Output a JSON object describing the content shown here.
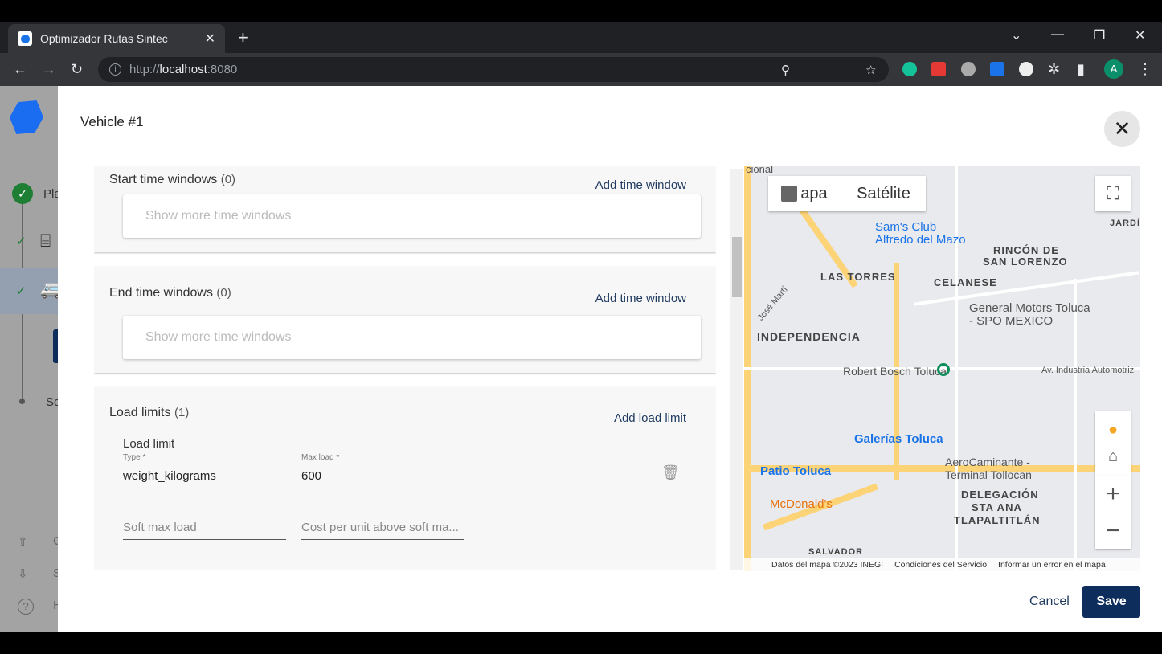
{
  "browser": {
    "tab_title": "Optimizador Rutas Sintec",
    "url_prefix": "http://",
    "url_host": "localhost",
    "url_port": ":8080"
  },
  "sidebar": {
    "step1": "Pla",
    "step4": "Sc",
    "footer": [
      "C",
      "S",
      "H"
    ]
  },
  "modal": {
    "title": "Vehicle #1",
    "start_tw": {
      "title": "Start time windows",
      "count": "(0)",
      "add": "Add time window",
      "more": "Show more time windows"
    },
    "end_tw": {
      "title": "End time windows",
      "count": "(0)",
      "add": "Add time window",
      "more": "Show more time windows"
    },
    "load": {
      "title": "Load limits",
      "count": "(1)",
      "add": "Add load limit",
      "item_title": "Load limit",
      "type_label": "Type *",
      "type_value": "weight_kilograms",
      "max_label": "Max load *",
      "max_value": "600",
      "soft_placeholder": "Soft max load",
      "cost_placeholder": "Cost per unit above soft ma..."
    },
    "cancel": "Cancel",
    "save": "Save"
  },
  "map": {
    "type_map": "apa",
    "type_sat": "Satélite",
    "labels": [
      "Sam's Club",
      "Alfredo del Mazo",
      "RINCÓN DE",
      "SAN LORENZO",
      "LAS TORRES",
      "CELANESE",
      "General Motors Toluca",
      "- SPO MEXICO",
      "INDEPENDENCIA",
      "Robert Bosch Toluca",
      "Av. Industria Automotriz",
      "Galerías Toluca",
      "Patio Toluca",
      "AeroCaminante -",
      "Terminal Tollocan",
      "McDonald's",
      "DELEGACIÓN",
      "STA ANA",
      "TLAPALTITLÁN",
      "SALVADOR",
      "José Martí",
      "JARDÍNE",
      "cional"
    ],
    "attribution": [
      "Datos del mapa ©2023 INEGI",
      "Condiciones del Servicio",
      "Informar un error en el mapa"
    ]
  },
  "colors": {
    "primary": "#0d2d5c",
    "step_done": "#1e7e34",
    "road": "#fcd376"
  }
}
